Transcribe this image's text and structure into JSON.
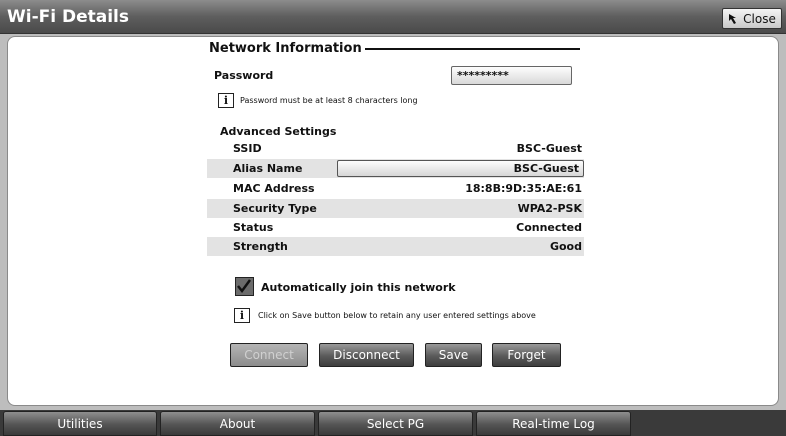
{
  "window": {
    "title": "Wi-Fi Details",
    "close_label": "Close"
  },
  "network": {
    "section_title": "Network Information",
    "password_label": "Password",
    "password_value": "*********",
    "password_hint": "Password must be at least 8 characters long",
    "advanced_title": "Advanced Settings",
    "rows": [
      {
        "label": "SSID",
        "value": "BSC-Guest"
      },
      {
        "label": "Alias Name",
        "value": "BSC-Guest"
      },
      {
        "label": "MAC Address",
        "value": "18:8B:9D:35:AE:61"
      },
      {
        "label": "Security Type",
        "value": "WPA2-PSK"
      },
      {
        "label": "Status",
        "value": "Connected"
      },
      {
        "label": "Strength",
        "value": "Good"
      }
    ],
    "auto_join_label": "Automatically join this network",
    "auto_join_checked": true,
    "save_hint": "Click on Save button below to retain any user entered settings above"
  },
  "actions": {
    "connect": "Connect",
    "disconnect": "Disconnect",
    "save": "Save",
    "forget": "Forget"
  },
  "taskbar": {
    "tabs": [
      "Utilities",
      "About",
      "Select PG",
      "Real-time Log"
    ]
  },
  "icons": {
    "info": "info-icon",
    "close": "arrow-cursor-icon",
    "check": "checkmark-icon"
  }
}
